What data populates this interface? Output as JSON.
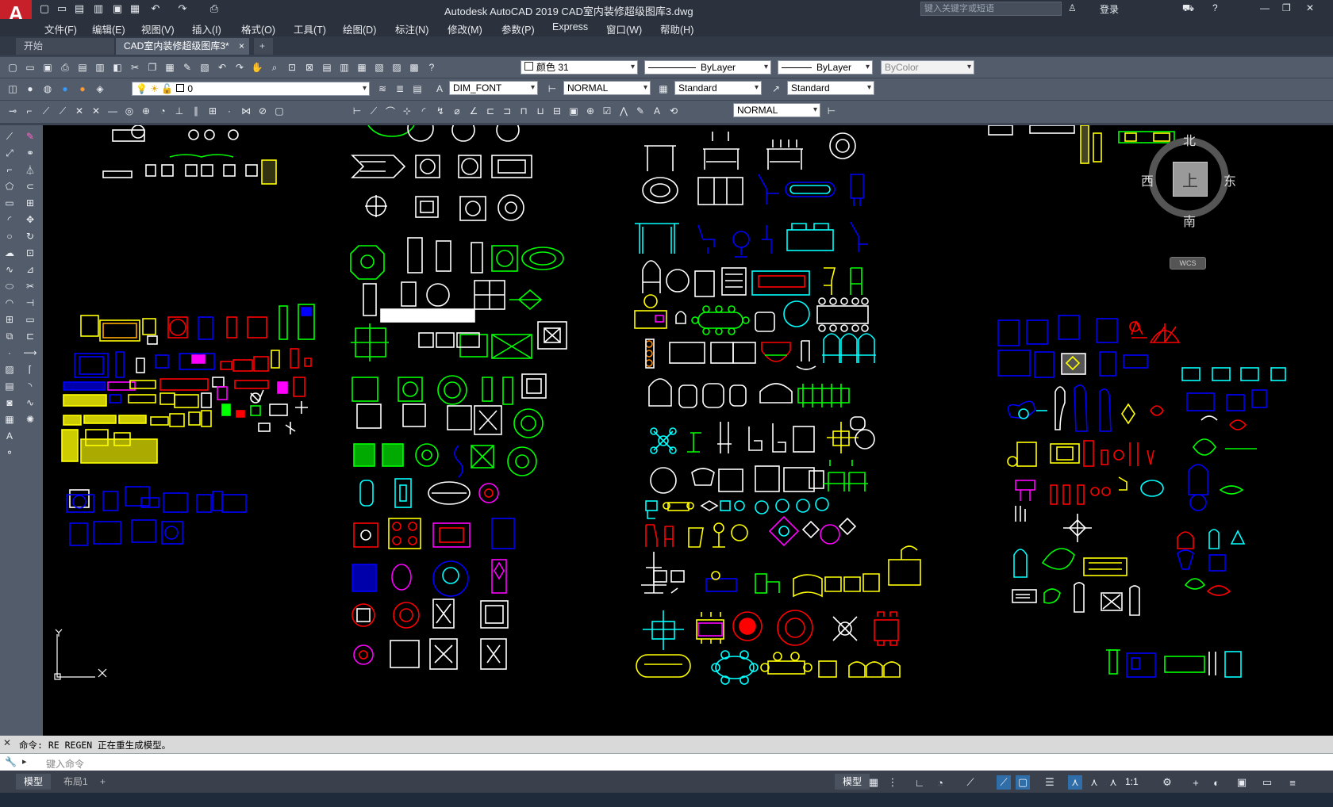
{
  "app": {
    "title": "Autodesk AutoCAD 2019    CAD室内装修超级图库3.dwg",
    "logo_letter": "A",
    "search_placeholder": "键入关键字或短语",
    "login": "登录",
    "accent": "#c8202a"
  },
  "menu": [
    "文件(F)",
    "编辑(E)",
    "视图(V)",
    "插入(I)",
    "格式(O)",
    "工具(T)",
    "绘图(D)",
    "标注(N)",
    "修改(M)",
    "参数(P)",
    "Express",
    "窗口(W)",
    "帮助(H)"
  ],
  "tabs": [
    {
      "label": "开始"
    },
    {
      "label": "CAD室内装修超级图库3*"
    }
  ],
  "toolbar1": {
    "color": "颜色 31",
    "linetype": "ByLayer",
    "lineweight": "ByLayer",
    "plotstyle": "ByColor"
  },
  "toolbar2": {
    "layer": "0",
    "textstyle": "DIM_FONT",
    "dimstyle": "NORMAL",
    "tablestyle": "Standard",
    "mleaderstyle": "Standard"
  },
  "toolbar3": {
    "visualstyle": "NORMAL"
  },
  "viewcube": {
    "north": "北",
    "south": "南",
    "east": "东",
    "west": "西",
    "face": "上",
    "wcs": "WCS"
  },
  "ucs": {
    "y": "Y",
    "x": "X"
  },
  "command": {
    "history": "命令: RE REGEN 正在重生成模型。",
    "placeholder": "键入命令"
  },
  "layout_tabs": [
    "模型",
    "布局1"
  ],
  "status": {
    "model": "模型",
    "scale": "1:1"
  },
  "icons": {
    "quick_access": [
      "new-icon",
      "open-icon",
      "save-icon",
      "saveas-icon",
      "undo-icon",
      "redo-icon",
      "plot-icon"
    ],
    "window": [
      "minimize-icon",
      "restore-icon",
      "close-icon"
    ]
  },
  "colors": {
    "canvas": "#000000",
    "white": "#ffffff",
    "green": "#00ff00",
    "blue": "#0000ff",
    "cyan": "#00ffff",
    "yellow": "#ffff00",
    "red": "#ff0000",
    "magenta": "#ff00ff",
    "orange": "#ffa500"
  }
}
